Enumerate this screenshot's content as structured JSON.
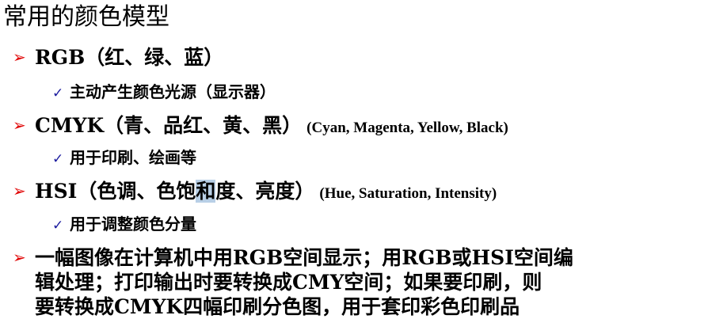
{
  "title": "常用的颜色模型",
  "models": [
    {
      "name": "RGB（红、绿、蓝）",
      "english": "",
      "usage": "主动产生颜色光源（显示器）"
    },
    {
      "name": "CMYK（青、品红、黄、黑）",
      "english": "(Cyan, Magenta, Yellow, Black)",
      "usage": "用于印刷、绘画等"
    },
    {
      "name_before_highlight": "HSI（色调、色饱",
      "name_highlight": "和",
      "name_after_highlight": "度、亮度）",
      "english": "(Hue, Saturation, Intensity)",
      "usage": "用于调整颜色分量"
    }
  ],
  "summary": {
    "line1": "一幅图像在计算机中用RGB空间显示；用RGB或HSI空间编",
    "line2": "辑处理；打印输出时要转换成CMY空间；如果要印刷，则",
    "line3": "要转换成CMYK四幅印刷分色图，用于套印彩色印刷品"
  },
  "icons": {
    "bullet": "➢",
    "check": "✓",
    "bullet_color": "#e00000",
    "check_color": "#1a1a9e",
    "highlight_color": "#b8cfe6"
  }
}
